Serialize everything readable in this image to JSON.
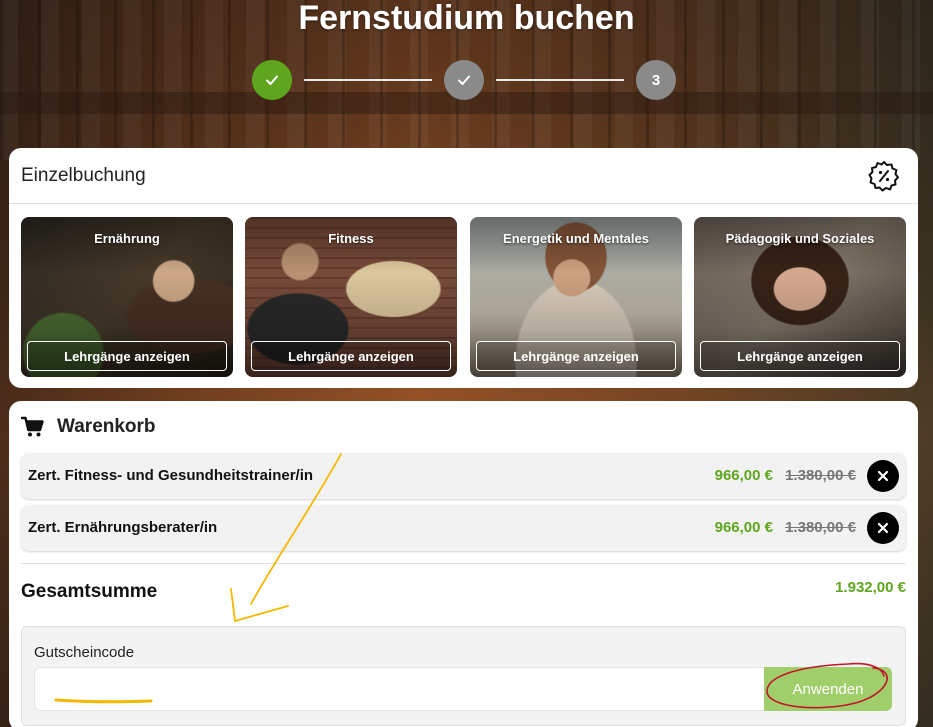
{
  "page": {
    "title": "Fernstudium buchen"
  },
  "stepper": {
    "steps": [
      {
        "state": "completed",
        "icon": "check-icon",
        "color": "#5fa61e"
      },
      {
        "state": "completed",
        "icon": "check-icon",
        "color": "#8a8a8a"
      },
      {
        "state": "current",
        "label": "3",
        "color": "#8a8a8a"
      }
    ]
  },
  "booking": {
    "title": "Einzelbuchung",
    "discount_icon": "discount-badge-icon",
    "categories": [
      {
        "title": "Ernährung",
        "button": "Lehrgänge anzeigen"
      },
      {
        "title": "Fitness",
        "button": "Lehrgänge anzeigen"
      },
      {
        "title": "Energetik und Mentales",
        "button": "Lehrgänge anzeigen"
      },
      {
        "title": "Pädagogik und Soziales",
        "button": "Lehrgänge anzeigen"
      }
    ]
  },
  "cart": {
    "icon": "shopping-cart-icon",
    "title": "Warenkorb",
    "items": [
      {
        "name": "Zert. Fitness- und Gesundheitstrainer/in",
        "price": "966,00 €",
        "old_price": "1.380,00 €"
      },
      {
        "name": "Zert. Ernährungsberater/in",
        "price": "966,00 €",
        "old_price": "1.380,00 €"
      }
    ],
    "total_label": "Gesamtsumme",
    "total_value": "1.932,00 €",
    "voucher": {
      "label": "Gutscheincode",
      "value": "",
      "placeholder": "",
      "apply_label": "Anwenden"
    }
  },
  "colors": {
    "accent_green": "#5fa61e",
    "apply_button": "#9fce6b",
    "annotation_yellow": "#f5b800",
    "annotation_red": "#c0162b"
  }
}
